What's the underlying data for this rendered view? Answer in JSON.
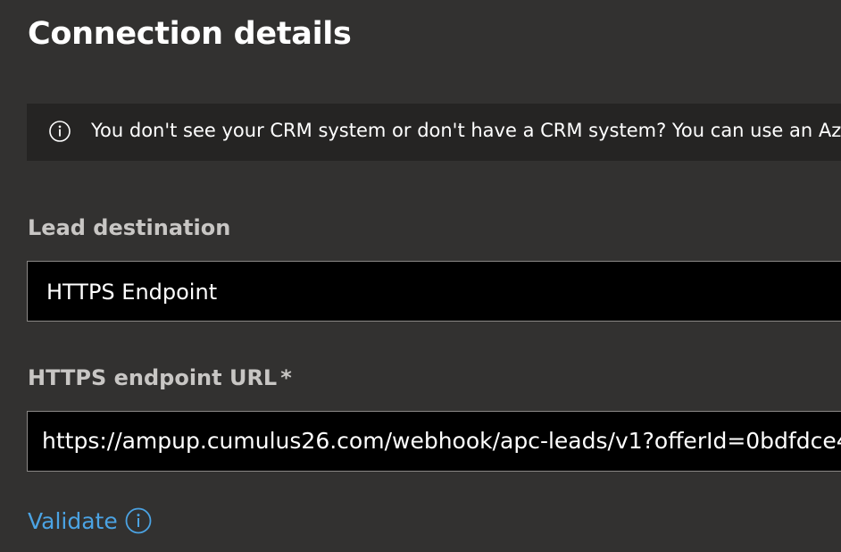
{
  "header": {
    "title": "Connection details"
  },
  "info_bar": {
    "icon": "info-icon",
    "text": "You don't see your CRM system or don't have a CRM system? You can use an Az"
  },
  "lead_destination": {
    "label": "Lead destination",
    "value": "HTTPS Endpoint"
  },
  "https_endpoint": {
    "label": "HTTPS endpoint URL",
    "required_marker": "*",
    "value": "https://ampup.cumulus26.com/webhook/apc-leads/v1?offerId=0bdfdce4"
  },
  "validate": {
    "label": "Validate",
    "icon": "info-icon"
  },
  "colors": {
    "background": "#323130",
    "info_bar": "#252423",
    "field_background": "#000000",
    "field_border": "#8a8886",
    "label": "#c8c6c4",
    "link": "#4ba3e3"
  }
}
